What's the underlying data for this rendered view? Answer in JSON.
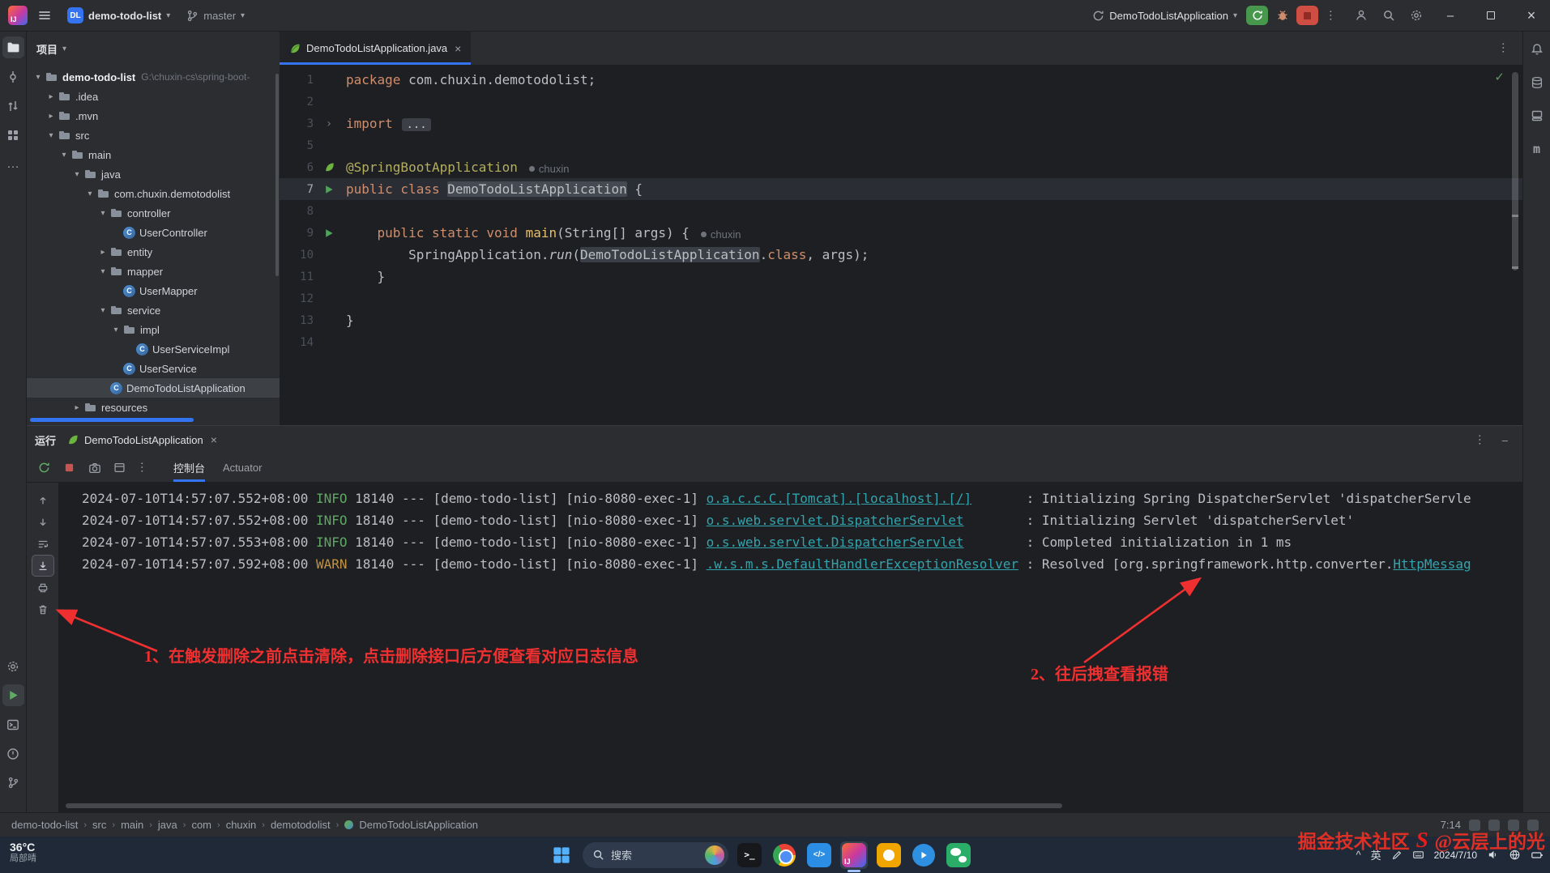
{
  "icons": {
    "dropdown_caret": "▾",
    "expanded_caret": "▾",
    "collapsed_caret": "▸",
    "breadcrumb_separator": "›",
    "more_vertical": "…",
    "close": "×",
    "minimize": "–",
    "check": "✓",
    "fold_arrow": "›",
    "tray_chevron": "^",
    "maven_m": "m"
  },
  "titlebar": {
    "logo_text": "IJ",
    "project_badge": "DL",
    "project_name": "demo-todo-list",
    "branch_name": "master",
    "run_config": "DemoTodoListApplication"
  },
  "project_panel": {
    "title": "项目",
    "tree": [
      {
        "label": "demo-todo-list",
        "hint": "G:\\chuxin-cs\\spring-boot-",
        "depth": 0,
        "icon": "project",
        "expand": "open",
        "bold": true
      },
      {
        "label": ".idea",
        "depth": 1,
        "icon": "folder",
        "expand": "closed"
      },
      {
        "label": ".mvn",
        "depth": 1,
        "icon": "folder",
        "expand": "closed"
      },
      {
        "label": "src",
        "depth": 1,
        "icon": "folder",
        "expand": "open"
      },
      {
        "label": "main",
        "depth": 2,
        "icon": "folder",
        "expand": "open"
      },
      {
        "label": "java",
        "depth": 3,
        "icon": "folder",
        "expand": "open"
      },
      {
        "label": "com.chuxin.demotodolist",
        "depth": 4,
        "icon": "package",
        "expand": "open"
      },
      {
        "label": "controller",
        "depth": 5,
        "icon": "package",
        "expand": "open"
      },
      {
        "label": "UserController",
        "depth": 6,
        "icon": "class",
        "expand": "none"
      },
      {
        "label": "entity",
        "depth": 5,
        "icon": "package",
        "expand": "closed"
      },
      {
        "label": "mapper",
        "depth": 5,
        "icon": "package",
        "expand": "open"
      },
      {
        "label": "UserMapper",
        "depth": 6,
        "icon": "class",
        "expand": "none"
      },
      {
        "label": "service",
        "depth": 5,
        "icon": "package",
        "expand": "open"
      },
      {
        "label": "impl",
        "depth": 6,
        "icon": "package",
        "expand": "open"
      },
      {
        "label": "UserServiceImpl",
        "depth": 7,
        "icon": "class",
        "expand": "none"
      },
      {
        "label": "UserService",
        "depth": 6,
        "icon": "class",
        "expand": "none"
      },
      {
        "label": "DemoTodoListApplication",
        "depth": 5,
        "icon": "class",
        "expand": "none",
        "selected": true
      },
      {
        "label": "resources",
        "depth": 3,
        "icon": "folder",
        "expand": "closed"
      }
    ]
  },
  "editor": {
    "tab_title": "DemoTodoListApplication.java",
    "lines": [
      {
        "num": "1",
        "tokens": [
          {
            "t": "package ",
            "c": "kw"
          },
          {
            "t": "com.chuxin.demotodolist;",
            "c": "d"
          }
        ]
      },
      {
        "num": "2",
        "tokens": []
      },
      {
        "num": "3",
        "gutter": "fold",
        "tokens": [
          {
            "t": "import ",
            "c": "kw"
          },
          {
            "t": "...",
            "c": "fold"
          }
        ]
      },
      {
        "num": "5",
        "tokens": []
      },
      {
        "num": "6",
        "gutter": "spring",
        "tokens": [
          {
            "t": "@SpringBootApplication",
            "c": "ann"
          },
          {
            "t": "chuxin",
            "c": "hint"
          }
        ]
      },
      {
        "num": "7",
        "gutter": "run",
        "current": true,
        "tokens": [
          {
            "t": "public class ",
            "c": "kw"
          },
          {
            "t": "DemoTodoListApplication",
            "c": "hl"
          },
          {
            "t": " {",
            "c": "d"
          }
        ]
      },
      {
        "num": "8",
        "tokens": []
      },
      {
        "num": "9",
        "gutter": "run",
        "tokens": [
          {
            "t": "    ",
            "c": "d"
          },
          {
            "t": "public static void ",
            "c": "kw"
          },
          {
            "t": "main",
            "c": "mth"
          },
          {
            "t": "(String[] args) {",
            "c": "d"
          },
          {
            "t": "chuxin",
            "c": "hint"
          }
        ]
      },
      {
        "num": "10",
        "tokens": [
          {
            "t": "        SpringApplication.",
            "c": "d"
          },
          {
            "t": "run",
            "c": "it"
          },
          {
            "t": "(",
            "c": "d"
          },
          {
            "t": "DemoTodoListApplication",
            "c": "hl2"
          },
          {
            "t": ".",
            "c": "d"
          },
          {
            "t": "class",
            "c": "kw"
          },
          {
            "t": ", args);",
            "c": "d"
          }
        ]
      },
      {
        "num": "11",
        "tokens": [
          {
            "t": "    }",
            "c": "d"
          }
        ]
      },
      {
        "num": "12",
        "tokens": []
      },
      {
        "num": "13",
        "tokens": [
          {
            "t": "}",
            "c": "d"
          }
        ]
      },
      {
        "num": "14",
        "tokens": []
      }
    ]
  },
  "run_panel": {
    "title": "运行",
    "tab_title": "DemoTodoListApplication",
    "console_tab": "控制台",
    "actuator_tab": "Actuator",
    "logs": [
      {
        "time": "2024-07-10T14:57:07.552+08:00",
        "level": "INFO",
        "pid": "18140",
        "app": "[demo-todo-list]",
        "thread": "[nio-8080-exec-1]",
        "logger": "o.a.c.c.C.[Tomcat].[localhost].[/]",
        "message": "Initializing Spring DispatcherServlet 'dispatcherServle"
      },
      {
        "time": "2024-07-10T14:57:07.552+08:00",
        "level": "INFO",
        "pid": "18140",
        "app": "[demo-todo-list]",
        "thread": "[nio-8080-exec-1]",
        "logger": "o.s.web.servlet.DispatcherServlet",
        "message": "Initializing Servlet 'dispatcherServlet'"
      },
      {
        "time": "2024-07-10T14:57:07.553+08:00",
        "level": "INFO",
        "pid": "18140",
        "app": "[demo-todo-list]",
        "thread": "[nio-8080-exec-1]",
        "logger": "o.s.web.servlet.DispatcherServlet",
        "message": "Completed initialization in 1 ms"
      },
      {
        "time": "2024-07-10T14:57:07.592+08:00",
        "level": "WARN",
        "pid": "18140",
        "app": "[demo-todo-list]",
        "thread": "[nio-8080-exec-1]",
        "logger": ".w.s.m.s.DefaultHandlerExceptionResolver",
        "message_prefix": "Resolved [org.springframework.http.converter.",
        "message_link": "HttpMessag"
      }
    ]
  },
  "annotations": {
    "note1": "1、在触发删除之前点击清除，点击删除接口后方便查看对应日志信息",
    "note2": "2、往后拽查看报错"
  },
  "status_bar": {
    "breadcrumbs": [
      "demo-todo-list",
      "src",
      "main",
      "java",
      "com",
      "chuxin",
      "demotodolist",
      "DemoTodoListApplication"
    ],
    "time": "7:14"
  },
  "taskbar": {
    "weather_temp": "36°C",
    "weather_desc": "局部晴",
    "search_placeholder": "搜索",
    "ime": "英",
    "date": "2024/7/10"
  },
  "watermark": {
    "part1": "掘金技术社区",
    "badge": "S",
    "part2": "@云层上的光"
  }
}
